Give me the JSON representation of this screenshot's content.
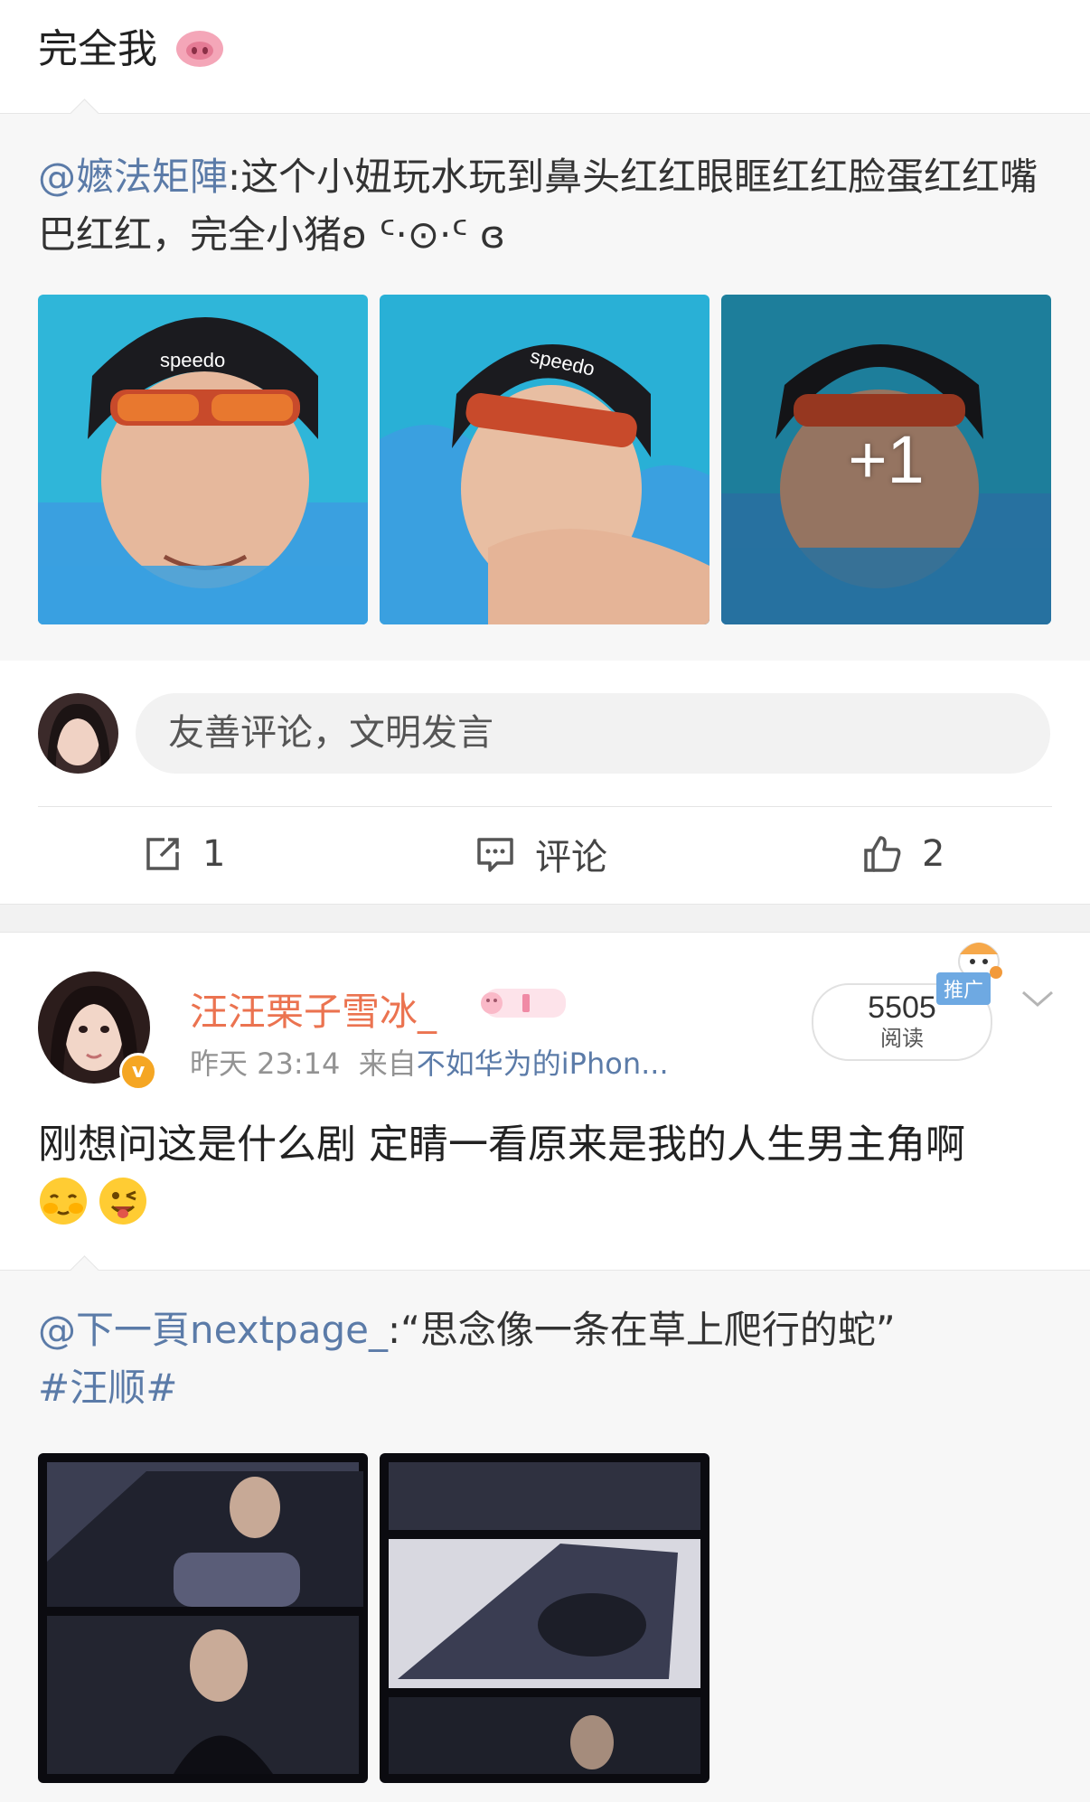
{
  "post1": {
    "text": "完全我",
    "repost": {
      "mention": "@嬷法矩陣",
      "body": ":这个小妞玩水玩到鼻头红红眼眶红红脸蛋红红嘴巴红红，完全小猪ʚ ᑦ·⊙·ᑦ ɞ"
    },
    "photos_more_badge": "+1"
  },
  "comment_bar": {
    "placeholder": "友善评论，文明发言"
  },
  "actions": {
    "repost_count": "1",
    "comment_label": "评论",
    "like_count": "2"
  },
  "post2": {
    "username": "汪汪栗子雪冰_",
    "verified_badge": "v",
    "time": "昨天 23:14",
    "from_prefix": "来自",
    "source": "不如华为的iPhon...",
    "reads": {
      "count": "5505",
      "label": "阅读"
    },
    "ad_tag": "推广",
    "text": "刚想问这是什么剧 定睛一看原来是我的人生男主角啊",
    "repost": {
      "mention": "@下一頁nextpage_",
      "body": ":“思念像一条在草上爬行的蛇”",
      "topic": "#汪顺#"
    }
  },
  "colors": {
    "link": "#5b7ba8",
    "username": "#eb7350",
    "repost_bg": "#f7f7f7",
    "pool": "#2fb6d9"
  }
}
